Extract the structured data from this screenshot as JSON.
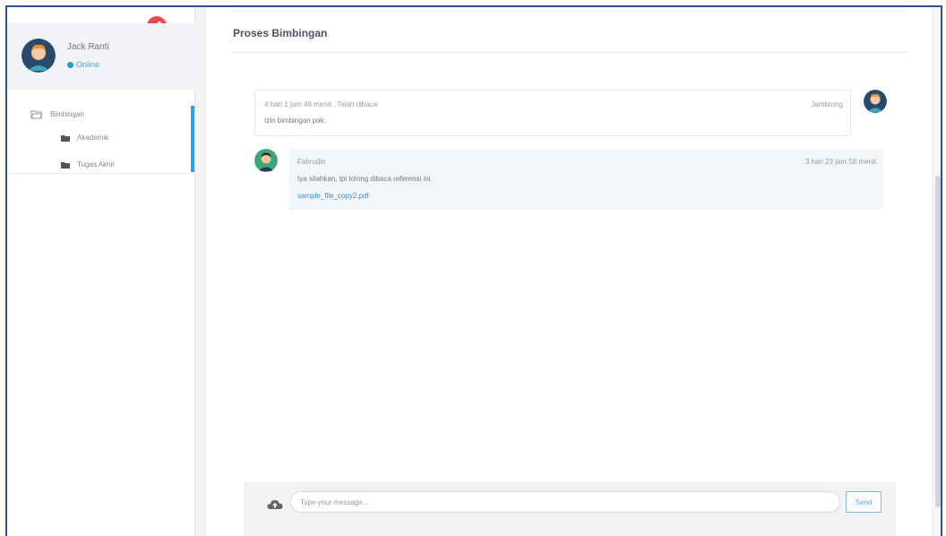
{
  "sidebar": {
    "user": {
      "name": "Jack Ranti",
      "status": "Online"
    },
    "nav": {
      "parent": "Bimbingan",
      "children": [
        "Akademik",
        "Tugas Akhir"
      ]
    }
  },
  "main": {
    "title": "Proses Bimbingan",
    "messages": [
      {
        "meta": "4 hari 1 jam 46 menit . Telah dibaca",
        "sender": "Jambrong",
        "text": "Izin bimbingan pak."
      },
      {
        "sender": "Fahrudin",
        "time": "3 hari 23 jam 58 menit",
        "text": "Iya silahkan, tpi tolong dibaca referensi ini.",
        "file": "sample_file_copy2.pdf"
      }
    ],
    "composer": {
      "placeholder": "Type your message...",
      "send_label": "Send"
    }
  },
  "colors": {
    "accent": "#29a2e6",
    "share": "#e8494d",
    "online": "#1e9be0"
  }
}
